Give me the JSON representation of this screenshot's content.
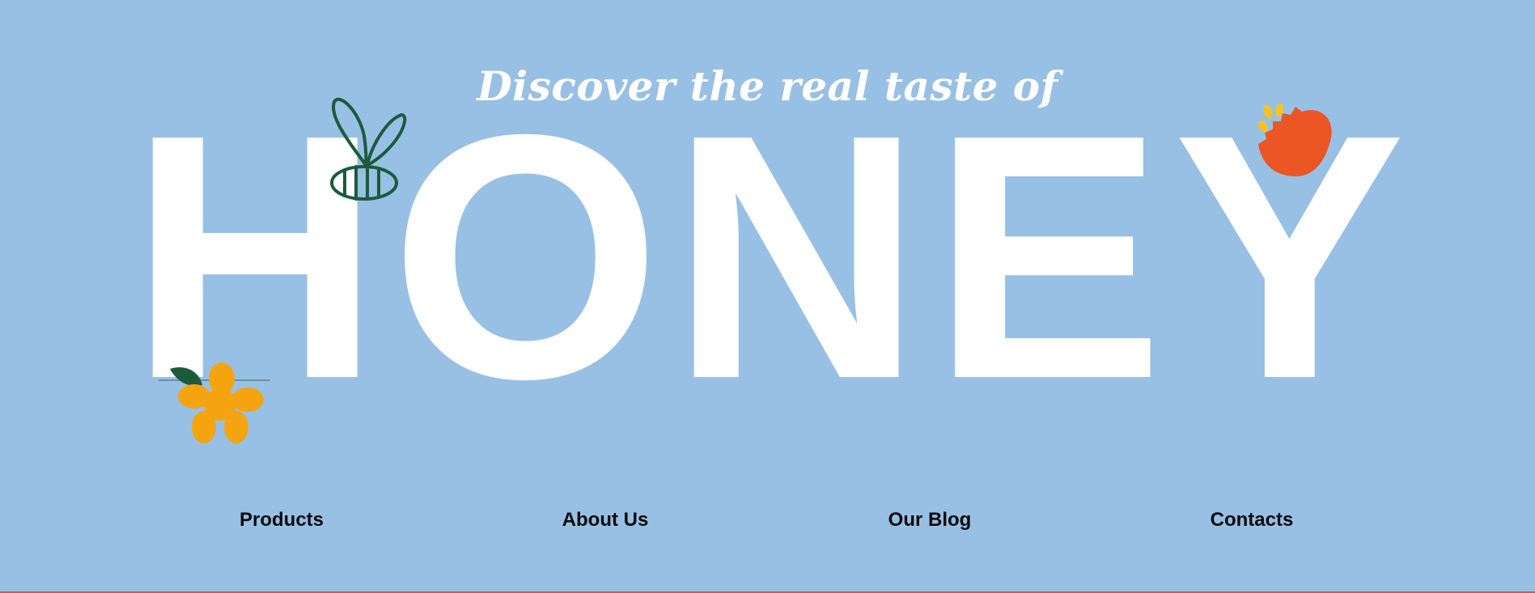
{
  "hero": {
    "tagline": "Discover the real taste of",
    "title_letters": [
      "H",
      "O",
      "N",
      "E",
      "Y"
    ],
    "background_color": "#98c0e4",
    "text_color": "#ffffff"
  },
  "decorations": {
    "bee": "bee-icon",
    "red_flower": "red-flower-icon",
    "yellow_flower": "yellow-flower-icon",
    "colors": {
      "bee": "#1d5a3c",
      "red_flower": "#ec5524",
      "red_flower_stamens": "#f2c328",
      "yellow_flower": "#f5a410",
      "leaf": "#1d5a3c"
    }
  },
  "nav": {
    "items": [
      {
        "label": "Products"
      },
      {
        "label": "About Us"
      },
      {
        "label": "Our Blog"
      },
      {
        "label": "Contacts"
      }
    ]
  }
}
